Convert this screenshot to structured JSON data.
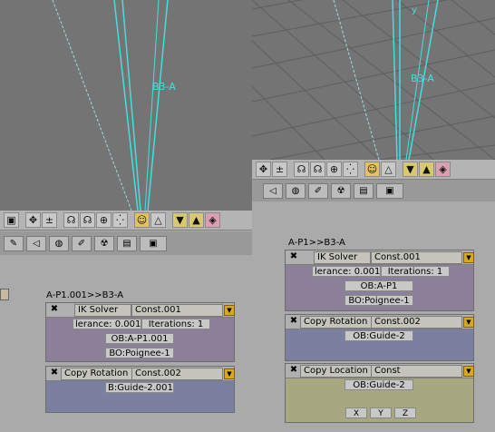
{
  "viewport_left": {
    "bone_label": "B3-A"
  },
  "viewport_right": {
    "bone_label": "B3-A",
    "axis_label": "y"
  },
  "header_icons": [
    "cube-icon",
    "move-icon",
    "scale-icon",
    "rotate-icon",
    "rotate-icon",
    "sphere-icon",
    "snap-icon",
    "proportional-icon",
    "mirror-icon",
    "pin-icon",
    "up-icon",
    "cone-icon"
  ],
  "header_glyphs": [
    "▣",
    "✥",
    "±",
    "☊",
    "☊",
    "⊕",
    "⁛",
    "☺",
    "△",
    "▼",
    "▲",
    "◈"
  ],
  "tab_glyphs": [
    "✎",
    "◁",
    "◍",
    "✐",
    "☢",
    "▤",
    "▣"
  ],
  "left_panel": {
    "title": "A-P1.001>>B3-A",
    "c1": {
      "x": "✖",
      "type": "IK Solver",
      "name": "Const.001",
      "tolerance": "lerance: 0.001",
      "iterations": "Iterations: 1",
      "ob": "OB:A-P1.001",
      "bo": "BO:Poignee-1"
    },
    "c2": {
      "x": "✖",
      "type": "Copy Rotation",
      "name": "Const.002",
      "target": "B:Guide-2.001"
    }
  },
  "right_panel": {
    "title": "A-P1>>B3-A",
    "c1": {
      "x": "✖",
      "type": "IK Solver",
      "name": "Const.001",
      "tolerance": "lerance: 0.001",
      "iterations": "Iterations: 1",
      "ob": "OB:A-P1",
      "bo": "BO:Poignee-1"
    },
    "c2": {
      "x": "✖",
      "type": "Copy Rotation",
      "name": "Const.002",
      "target": "OB:Guide-2"
    },
    "c3": {
      "x": "✖",
      "type": "Copy Location",
      "name": "Const",
      "target": "OB:Guide-2",
      "axes": [
        "X",
        "Y",
        "Z"
      ]
    }
  },
  "colors": {
    "ik_body": "#8c8098",
    "rot_body": "#7c80a0",
    "loc_body": "#a8a880",
    "bone": "#40e0e0",
    "accent": "#d8a820"
  }
}
